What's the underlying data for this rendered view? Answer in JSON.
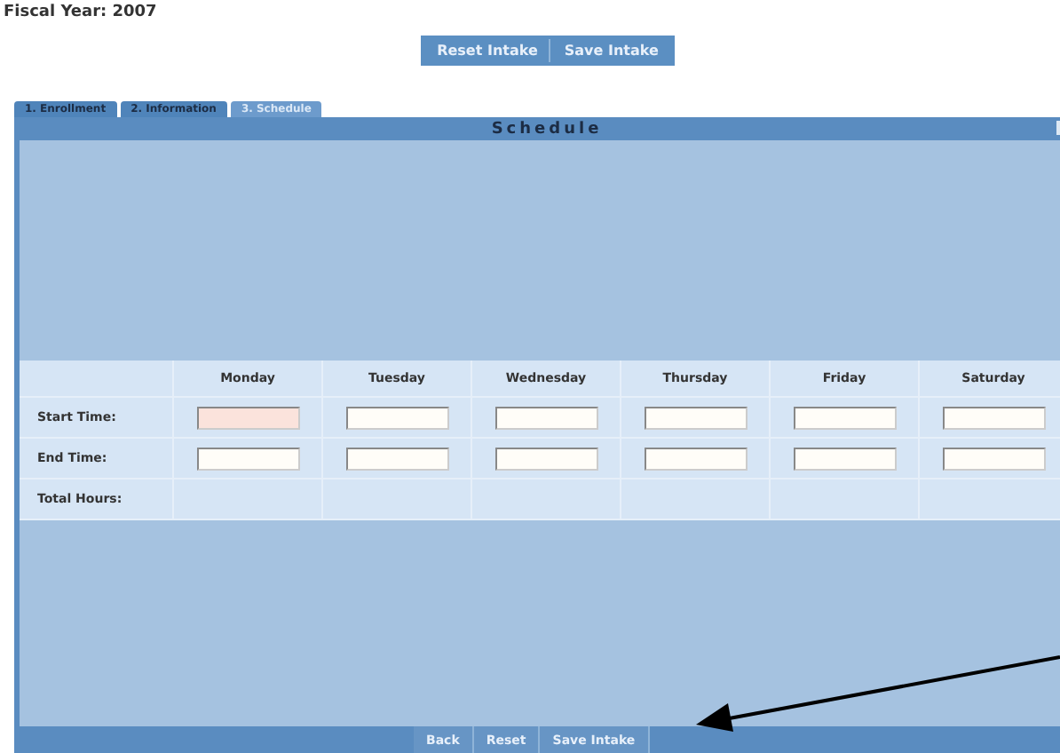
{
  "fiscal_year": "Fiscal Year: 2007",
  "top_buttons": [
    "Reset Intake",
    "Save Intake"
  ],
  "tabs": [
    {
      "label": "1. Enrollment",
      "selected": false
    },
    {
      "label": "2. Information",
      "selected": false
    },
    {
      "label": "3. Schedule",
      "selected": true
    }
  ],
  "panel": {
    "title": "Schedule"
  },
  "schedule": {
    "columns": [
      "Monday",
      "Tuesday",
      "Wednesday",
      "Thursday",
      "Friday",
      "Saturday"
    ],
    "rows": [
      {
        "label": "Start Time:",
        "kind": "inputs",
        "fields": [
          {
            "highlighted": true
          },
          {
            "highlighted": false
          },
          {
            "highlighted": false
          },
          {
            "highlighted": false
          },
          {
            "highlighted": false
          },
          {
            "highlighted": false
          }
        ]
      },
      {
        "label": "End Time:",
        "kind": "inputs",
        "fields": [
          {
            "highlighted": false
          },
          {
            "highlighted": false
          },
          {
            "highlighted": false
          },
          {
            "highlighted": false
          },
          {
            "highlighted": false
          },
          {
            "highlighted": false
          }
        ]
      },
      {
        "label": "Total Hours:",
        "kind": "totals"
      }
    ]
  },
  "bottom_buttons": [
    "Back",
    "Reset",
    "Save Intake"
  ]
}
